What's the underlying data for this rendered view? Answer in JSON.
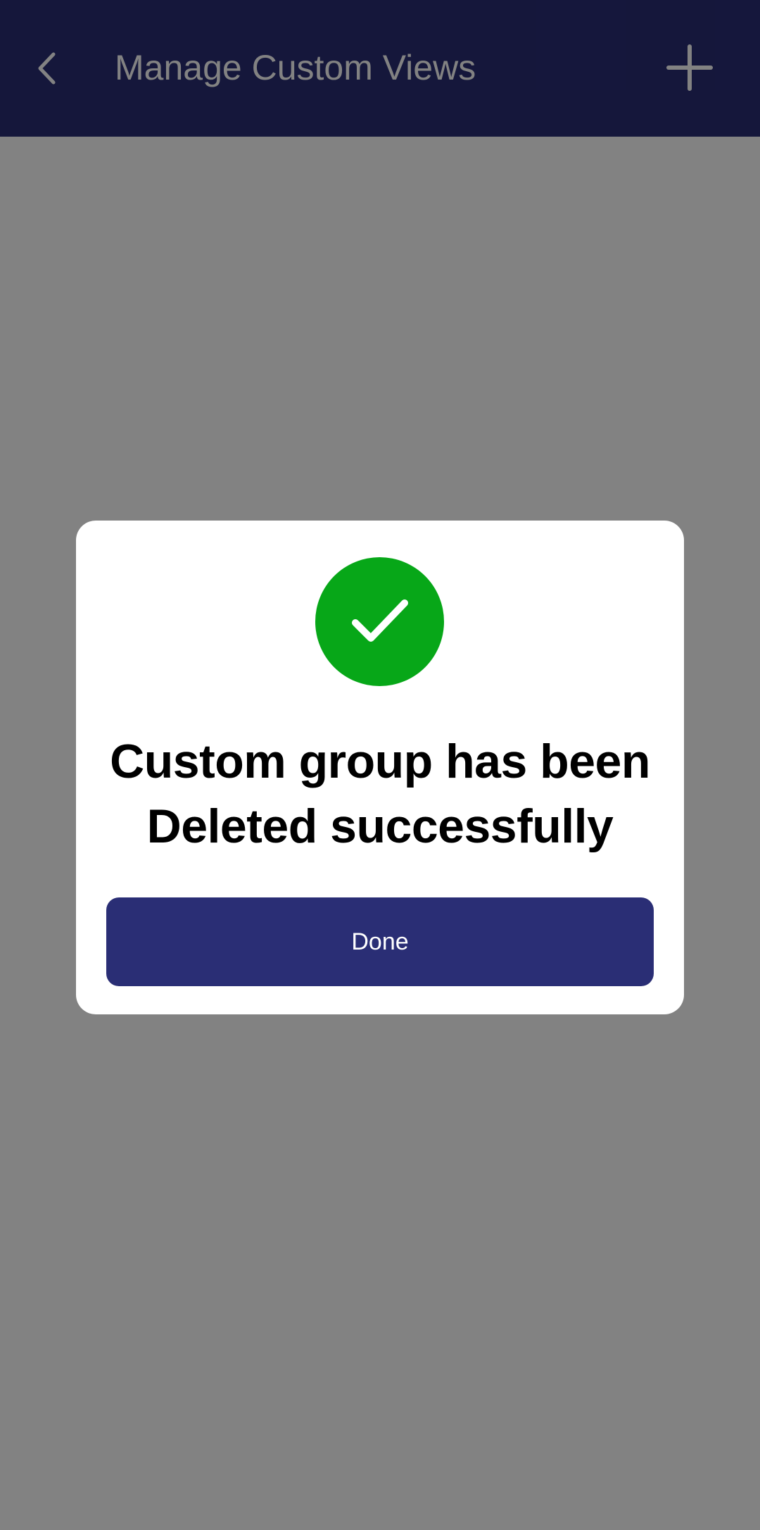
{
  "app_bar": {
    "title": "Manage Custom Views",
    "back_icon": "chevron-left-icon",
    "add_icon": "plus-icon",
    "background_color": "#2a2e75"
  },
  "dialog": {
    "icon": "check-circle-icon",
    "icon_color": "#07a718",
    "message_line1": "Custom group has been",
    "message_line2": "Deleted successfully",
    "done_label": "Done",
    "button_color": "#2a2e75"
  }
}
